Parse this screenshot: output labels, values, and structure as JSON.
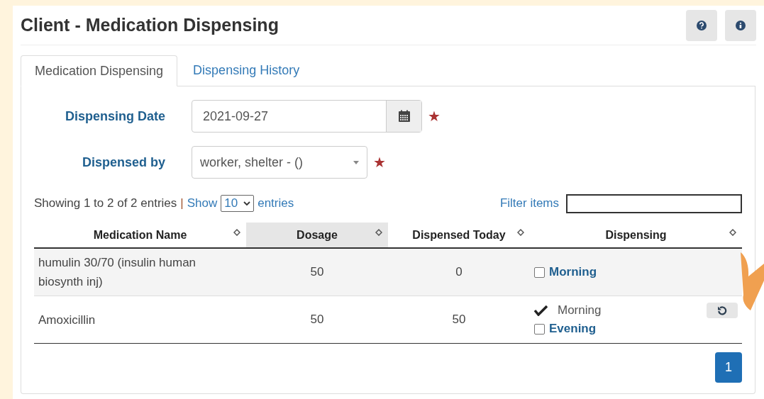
{
  "page": {
    "title": "Client - Medication Dispensing",
    "header_buttons": [
      {
        "kind": "help"
      },
      {
        "kind": "info"
      }
    ]
  },
  "tabs": [
    {
      "label": "Medication Dispensing",
      "selected": true
    },
    {
      "label": "Dispensing History",
      "selected": false
    }
  ],
  "form": {
    "fields": [
      {
        "kind": "date",
        "label": "Dispensing Date",
        "value": "2021-09-27",
        "required_mark": "★"
      },
      {
        "kind": "select",
        "label": "Dispensed by",
        "value": "worker, shelter - ()",
        "required_mark": "★"
      }
    ]
  },
  "table_controls": {
    "summary": "Showing 1 to 2 of 2 entries",
    "separator": "|",
    "show_label": "Show",
    "page_size": "10",
    "entries_label": "entries",
    "filter_label": "Filter items"
  },
  "table": {
    "columns": [
      {
        "label": "Medication Name",
        "selected": false
      },
      {
        "label": "Dosage",
        "selected": true
      },
      {
        "label": "Dispensed Today",
        "selected": false
      },
      {
        "label": "Dispensing",
        "selected": false
      }
    ],
    "rows": [
      {
        "name": "humulin 30/70 (insulin human biosynth inj)",
        "dosage": "50",
        "dispensed_today": "0",
        "undo": false,
        "slots": [
          {
            "kind": "pending",
            "label": "Morning",
            "checked": false
          }
        ]
      },
      {
        "name": "Amoxicillin",
        "dosage": "50",
        "dispensed_today": "50",
        "undo": true,
        "slots": [
          {
            "kind": "done",
            "label": "Morning"
          },
          {
            "kind": "pending",
            "label": "Evening",
            "checked": false
          }
        ]
      }
    ]
  },
  "pagination": [
    {
      "label": "1",
      "selected": true
    }
  ]
}
